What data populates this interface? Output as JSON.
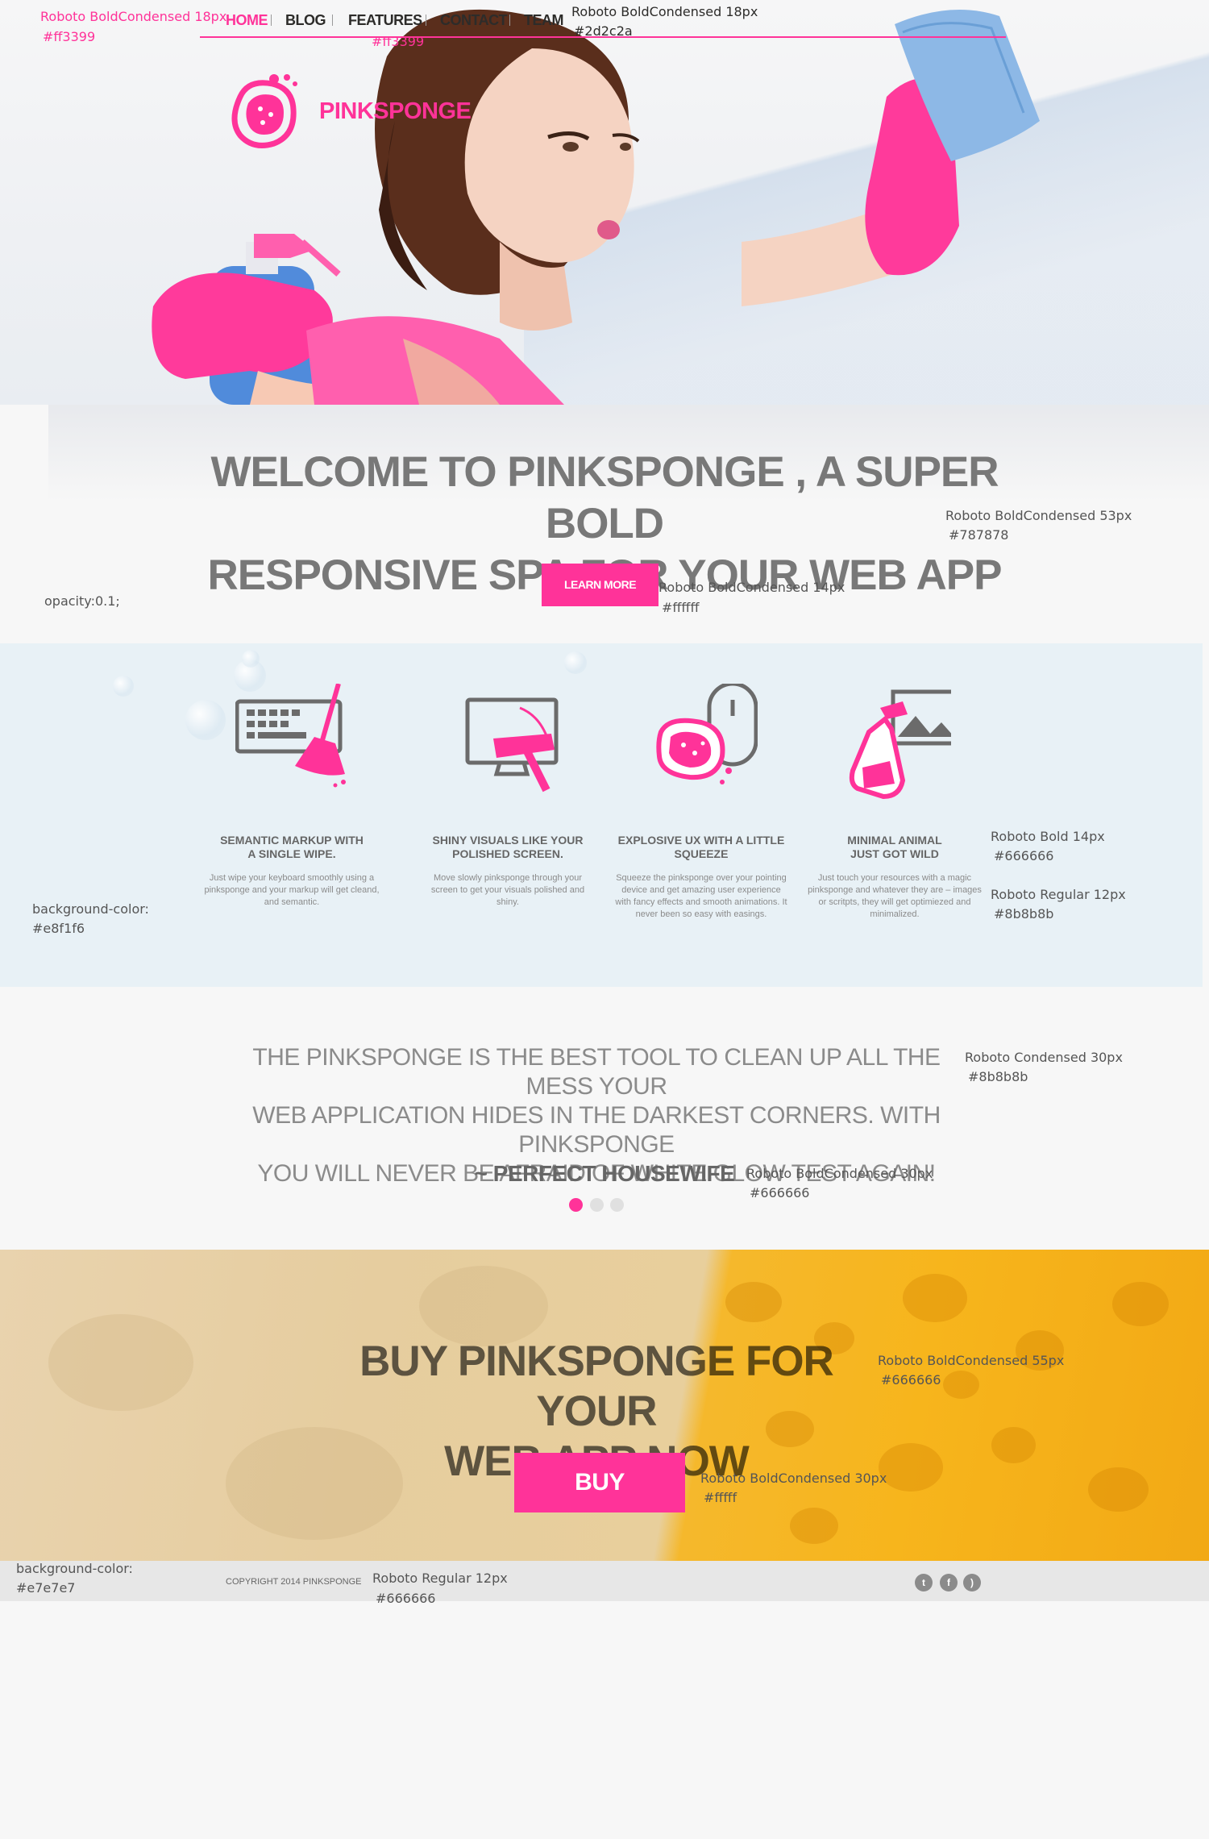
{
  "colors": {
    "accent": "#ff3399",
    "nav_text": "#2d2c2a",
    "heading": "#787878",
    "body_text": "#666666",
    "muted": "#8b8b8b",
    "features_bg": "#e8f1f6",
    "footer_bg": "#e7e7e7"
  },
  "nav": {
    "items": [
      {
        "label": "HOME",
        "active": true
      },
      {
        "label": "BLOG",
        "active": false
      },
      {
        "label": "FEATURES",
        "active": false
      },
      {
        "label": "CONTACT",
        "active": false
      },
      {
        "label": "TEAM",
        "active": false
      }
    ]
  },
  "brand": {
    "name": "PINKSPONGE",
    "logo_icon": "sponge-icon"
  },
  "hero": {
    "title_line1": "WELCOME TO  PINKSPONGE , A SUPER BOLD",
    "title_line2": "RESPONSIVE SPA  FOR YOUR WEB APP",
    "cta_label": "LEARN MORE"
  },
  "features": [
    {
      "icon": "keyboard-broom-icon",
      "title_line1": "SEMANTIC MARKUP WITH",
      "title_line2": "A SINGLE WIPE.",
      "desc": "Just wipe your keyboard smoothly using a pinksponge and your markup will get cleand, and semantic."
    },
    {
      "icon": "monitor-squeegee-icon",
      "title_line1": "SHINY VISUALS LIKE YOUR",
      "title_line2": "POLISHED SCREEN.",
      "desc": "Move slowly pinksponge through your screen to get your visuals polished and shiny."
    },
    {
      "icon": "mouse-sponge-icon",
      "title_line1": "EXPLOSIVE UX WITH A LITTLE",
      "title_line2": "SQUEEZE",
      "desc": "Squeeze the pinksponge over your pointing device and get amazing user experience with fancy effects and smooth animations. It never been so easy with easings."
    },
    {
      "icon": "image-spray-icon",
      "title_line1": "MINIMAL ANIMAL",
      "title_line2": "JUST GOT WILD",
      "desc": "Just touch your resources with a magic pinksponge and whatever they are – images or scritpts, they will get optimiezed and minimalized."
    }
  ],
  "quote": {
    "line1": "THE PINKSPONGE IS THE BEST TOOL TO CLEAN UP ALL THE MESS YOUR",
    "line2": "WEB APPLICATION HIDES IN THE DARKEST CORNERS. WITH PINKSPONGE",
    "line3": "YOU WILL NEVER BE AFRAID OF WHITE GLOW TEST AGAIN!",
    "author": "~ PERFECT HOUSEWIFE",
    "active_dot": 0
  },
  "buy": {
    "title_line1": "BUY PINKSPONGE FOR YOUR",
    "title_line2": "WEB APP NOW",
    "button_label": "BUY"
  },
  "footer": {
    "copyright": "COPYRIGHT 2014 PINKSPONGE",
    "social": [
      {
        "icon": "twitter-icon",
        "glyph": "t"
      },
      {
        "icon": "facebook-icon",
        "glyph": "f"
      },
      {
        "icon": "rss-icon",
        "glyph": ")"
      }
    ]
  },
  "annotations": {
    "nav_active_font": "Roboto BoldCondensed 18px",
    "nav_active_color": "#ff3399",
    "nav_sep_color": "#ff3399",
    "nav_font": "Roboto BoldCondensed 18px",
    "nav_color": "#2d2c2a",
    "welcome_font": "Roboto BoldCondensed 53px",
    "welcome_color": "#787878",
    "btn_font": "Roboto BoldCondensed 14px",
    "btn_color": "#ffffff",
    "opacity": "opacity:0.1;",
    "features_bg_label": "background-color:",
    "features_bg_value": "#e8f1f6",
    "feat_title_font": "Roboto Bold 14px",
    "feat_title_color": "#666666",
    "feat_desc_font": "Roboto Regular 12px",
    "feat_desc_color": "#8b8b8b",
    "quote_font": "Roboto Condensed 30px",
    "quote_color": "#8b8b8b",
    "author_font": "Roboto BoldCondensed 30px",
    "author_color": "#666666",
    "buy_font": "Roboto BoldCondensed 55px",
    "buy_color": "#666666",
    "buy_btn_font": "Roboto BoldCondensed 30px",
    "buy_btn_color": "#fffff",
    "footer_bg_label": "background-color:",
    "footer_bg_value": "#e7e7e7",
    "footer_font": "Roboto Regular 12px",
    "footer_color": "#666666"
  }
}
